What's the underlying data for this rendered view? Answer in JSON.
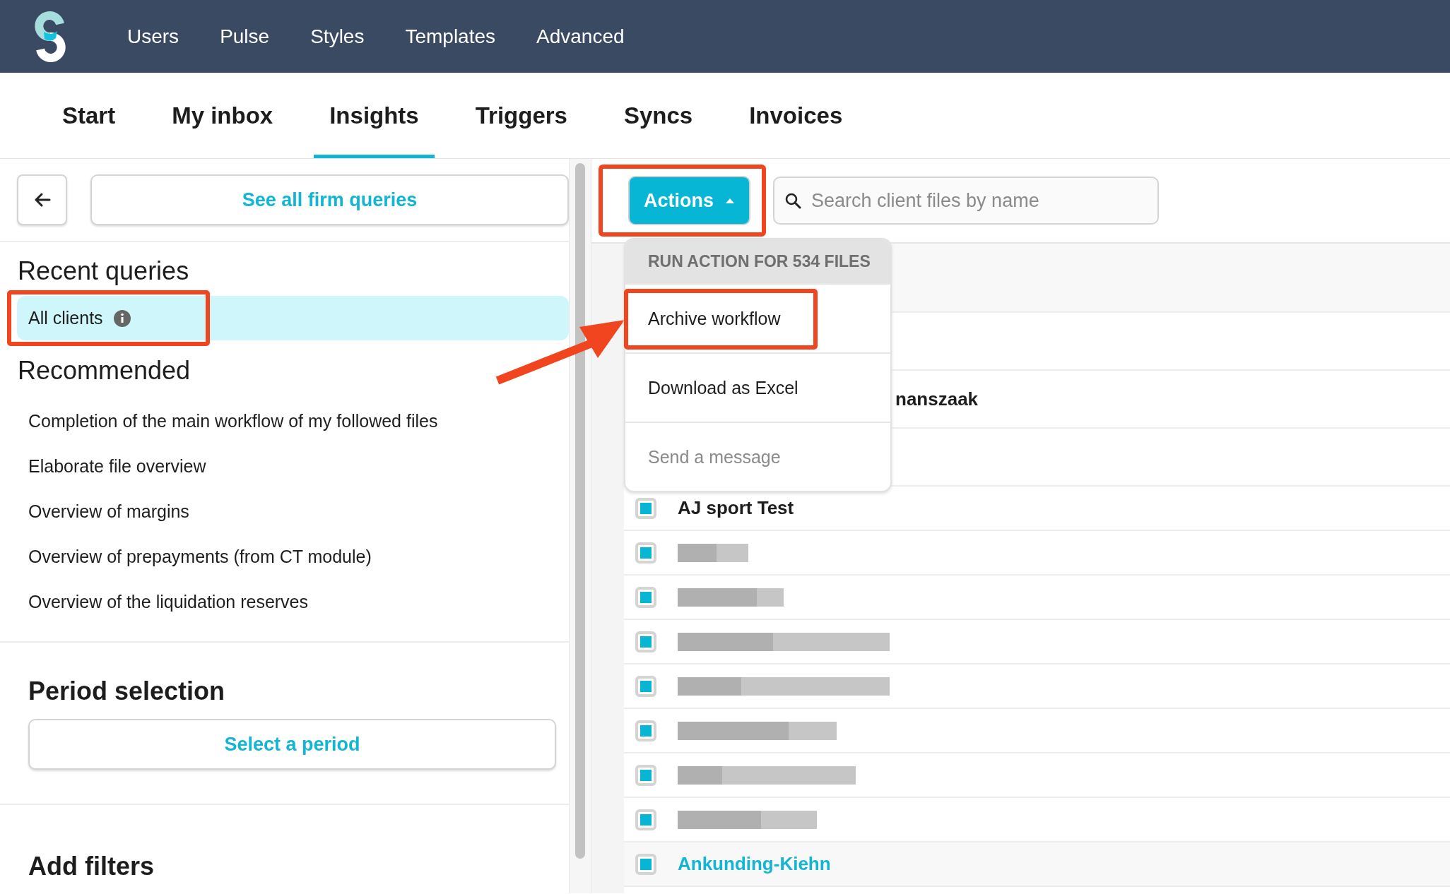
{
  "top_nav": {
    "items": [
      "Users",
      "Pulse",
      "Styles",
      "Templates",
      "Advanced"
    ]
  },
  "tabs": [
    {
      "label": "Start",
      "selected": false
    },
    {
      "label": "My inbox",
      "selected": false
    },
    {
      "label": "Insights",
      "selected": true
    },
    {
      "label": "Triggers",
      "selected": false
    },
    {
      "label": "Syncs",
      "selected": false
    },
    {
      "label": "Invoices",
      "selected": false
    }
  ],
  "sidebar": {
    "see_all_button": "See all firm queries",
    "recent": {
      "title": "Recent queries",
      "items": [
        {
          "label": "All clients",
          "selected": true,
          "info": true,
          "highlighted": true
        }
      ]
    },
    "recommended": {
      "title": "Recommended",
      "items": [
        "Completion of the main workflow of my followed files",
        "Elaborate file overview",
        "Overview of margins",
        "Overview of prepayments (from CT module)",
        "Overview of the liquidation reserves"
      ]
    },
    "period": {
      "title": "Period selection",
      "button": "Select a period"
    },
    "filters": {
      "title": "Add filters"
    }
  },
  "toolbar": {
    "actions_button": {
      "label": "Actions",
      "expanded": true,
      "highlighted": true
    },
    "search": {
      "placeholder": "Search client files by name"
    }
  },
  "actions_menu": {
    "header": "RUN ACTION FOR 534 FILES",
    "items": [
      {
        "label": "Archive workflow",
        "disabled": false,
        "highlighted": true
      },
      {
        "label": "Download as Excel",
        "disabled": false,
        "highlighted": false
      },
      {
        "label": "Send a message",
        "disabled": true,
        "highlighted": false
      }
    ]
  },
  "file_list": {
    "rows": [
      {
        "kind": "hidden"
      },
      {
        "kind": "cut",
        "name": "nanszaak"
      },
      {
        "kind": "hidden"
      },
      {
        "kind": "name",
        "name": "AJ sport Test",
        "checked": true
      },
      {
        "kind": "redacted",
        "checked": true
      },
      {
        "kind": "redacted",
        "checked": true
      },
      {
        "kind": "redacted",
        "checked": true
      },
      {
        "kind": "redacted",
        "checked": true
      },
      {
        "kind": "redacted",
        "checked": true
      },
      {
        "kind": "redacted",
        "checked": true
      },
      {
        "kind": "redacted",
        "checked": true
      },
      {
        "kind": "link",
        "name": "Ankunding-Kiehn",
        "checked": true
      }
    ]
  }
}
